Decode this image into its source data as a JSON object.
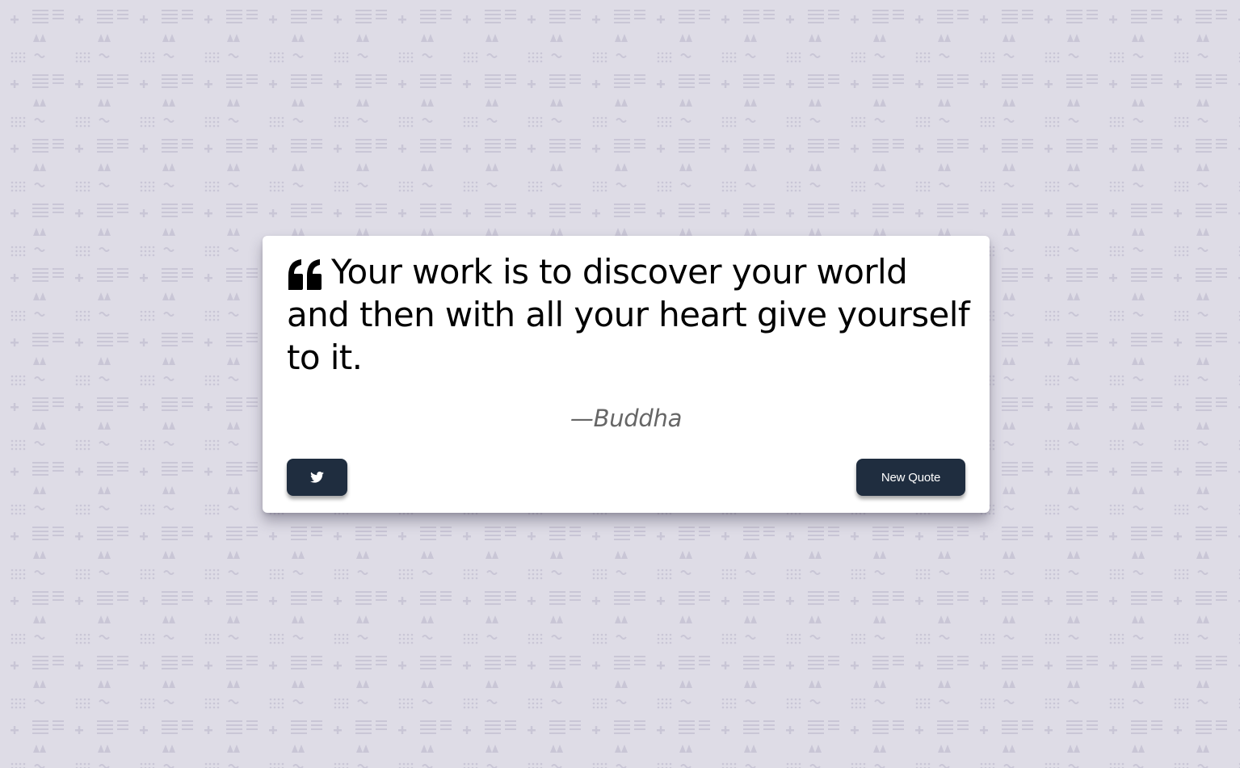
{
  "quote": {
    "text": "Your work is to discover your world and then with all your heart give yourself to it.",
    "author": "—Buddha",
    "quote_icon": "quote-left-icon"
  },
  "actions": {
    "tweet_icon": "twitter-icon",
    "new_quote_label": "New Quote"
  },
  "colors": {
    "background": "#dedce6",
    "pattern": "#c7c4d4",
    "card": "#ffffff",
    "button": "#1f2d3f",
    "author_text": "#666666"
  }
}
